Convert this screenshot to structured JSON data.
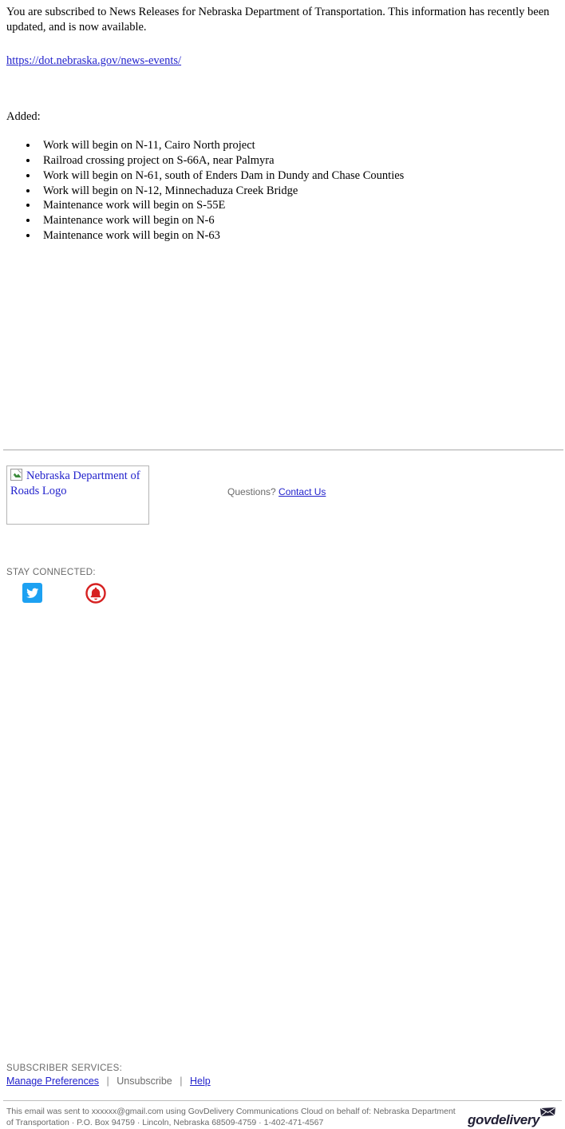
{
  "message": {
    "intro": "You are subscribed to News Releases for Nebraska Department of Transportation. This information has recently been updated, and is now available.",
    "url": "https://dot.nebraska.gov/news-events/",
    "added_label": "Added:",
    "items": [
      "Work will begin on N-11, Cairo North project",
      "Railroad crossing project on S-66A, near Palmyra",
      "Work will begin on N-61, south of Enders Dam in Dundy and Chase Counties",
      "Work will begin on N-12, Minnechaduza Creek Bridge",
      "Maintenance work will begin on S-55E",
      "Maintenance work will begin on N-6",
      "Maintenance work will begin on N-63"
    ]
  },
  "footer": {
    "logo_alt": "Nebraska Department of Roads Logo",
    "questions_label": "Questions?",
    "contact_link": "Contact Us",
    "stay_connected_label": "STAY CONNECTED:",
    "social": [
      {
        "name": "twitter-icon",
        "label": "Twitter",
        "color": "#1da1f2"
      },
      {
        "name": "bell-icon",
        "label": "Subscribe",
        "color": "#d62121"
      }
    ],
    "subscriber_label": "SUBSCRIBER SERVICES:",
    "subscriber_links": {
      "manage": "Manage Preferences",
      "unsubscribe": "Unsubscribe",
      "help": "Help",
      "separator": "|"
    },
    "legal_line1": "This email was sent to xxxxxx@gmail.com using GovDelivery Communications Cloud on behalf of: Nebraska Department of",
    "legal_line2": "Transportation · P.O. Box 94759 · Lincoln, Nebraska 68509-4759 · 1-402-471-4567",
    "brand": "govdelivery"
  },
  "colors": {
    "link": "#2222cc",
    "muted_text": "#6a6a6a",
    "rule": "#a9a9a9",
    "brand_dark": "#211f35"
  }
}
